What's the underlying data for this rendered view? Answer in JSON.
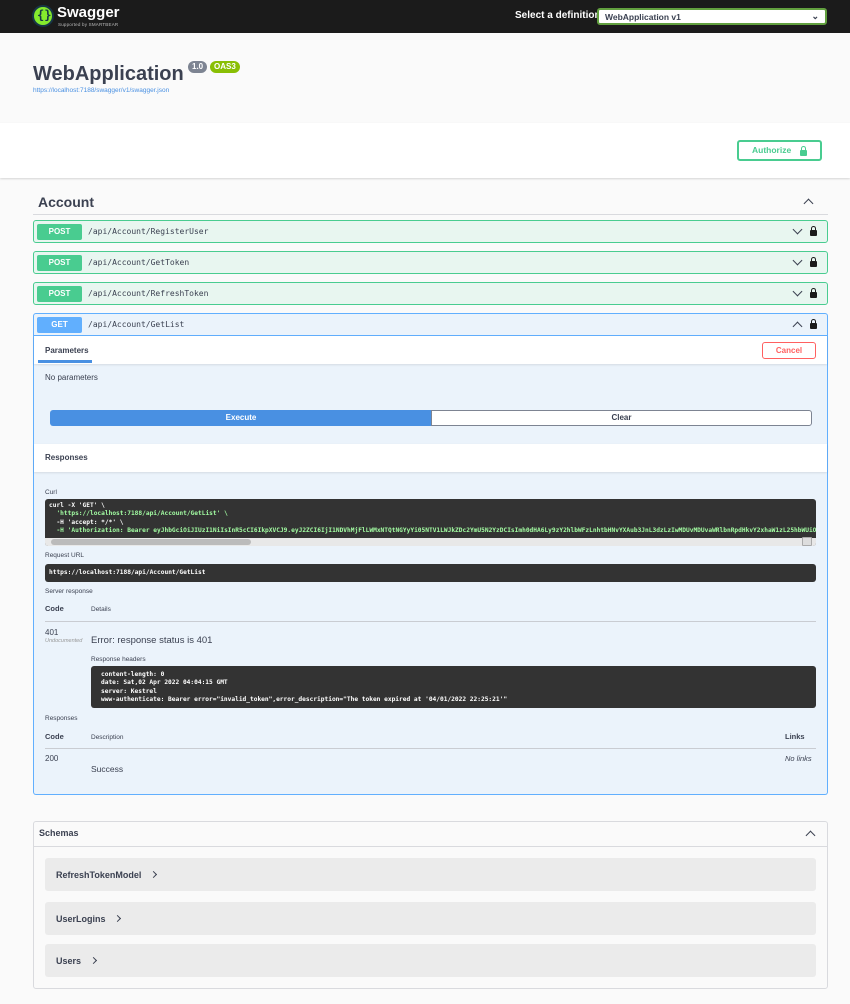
{
  "topbar": {
    "logo_text": "Swagger",
    "logo_sub": "Supported by SMARTBEAR",
    "definition_label": "Select a definition",
    "definition_value": "WebApplication v1"
  },
  "info": {
    "title": "WebApplication",
    "version": "1.0",
    "oas": "OAS3",
    "json_url": "https://localhost:7188/swagger/v1/swagger.json"
  },
  "authorize": {
    "label": "Authorize"
  },
  "tag": {
    "name": "Account"
  },
  "operations": [
    {
      "method": "POST",
      "path": "/api/Account/RegisterUser"
    },
    {
      "method": "POST",
      "path": "/api/Account/GetToken"
    },
    {
      "method": "POST",
      "path": "/api/Account/RefreshToken"
    },
    {
      "method": "GET",
      "path": "/api/Account/GetList"
    }
  ],
  "get_body": {
    "parameters_tab": "Parameters",
    "cancel_label": "Cancel",
    "no_parameters": "No parameters",
    "execute_label": "Execute",
    "clear_label": "Clear",
    "responses_title": "Responses",
    "curl_label": "Curl",
    "curl_lines": [
      "curl -X 'GET' \\",
      "  'https://localhost:7188/api/Account/GetList' \\",
      "  -H 'accept: */*' \\",
      "  -H 'Authorization: Bearer eyJhbGciOiJIUzI1NiIsInR5cCI6IkpXVCJ9.eyJ2ZCI6IjI1NDVhMjFlLWMxNTQtNGYyYi05NTV1LWJkZDc2YmU5N2YzDCIsImh0dHA6Ly9zY2hlbWFzLnhtbHNvYXAub3JnL3dzLzIwMDUvMDUvaWRlbnRpdHkvY2xhaW1zL25hbWUiOiJ"
    ],
    "request_url_label": "Request URL",
    "request_url": "https://localhost:7188/api/Account/GetList",
    "server_response_label": "Server response",
    "code_header": "Code",
    "details_header": "Details",
    "response_code": "401",
    "undocumented": "Undocumented",
    "error_text": "Error: response status is 401",
    "response_headers_label": "Response headers",
    "response_headers": [
      "content-length: 0",
      "date: Sat,02 Apr 2022 04:04:15 GMT",
      "server: Kestrel",
      "www-authenticate: Bearer error=\"invalid_token\",error_description=\"The token expired at '04/01/2022 22:25:21'\""
    ],
    "responses_label": "Responses",
    "description_header": "Description",
    "links_header": "Links",
    "doc_code": "200",
    "doc_description": "Success",
    "no_links": "No links"
  },
  "schemas": {
    "title": "Schemas",
    "models": [
      "RefreshTokenModel",
      "UserLogins",
      "Users"
    ]
  },
  "colors": {
    "post": "#49cc90",
    "get": "#61affe",
    "execute": "#4990e2",
    "cancel": "#ff6060",
    "topbar": "#1b1b1b"
  }
}
